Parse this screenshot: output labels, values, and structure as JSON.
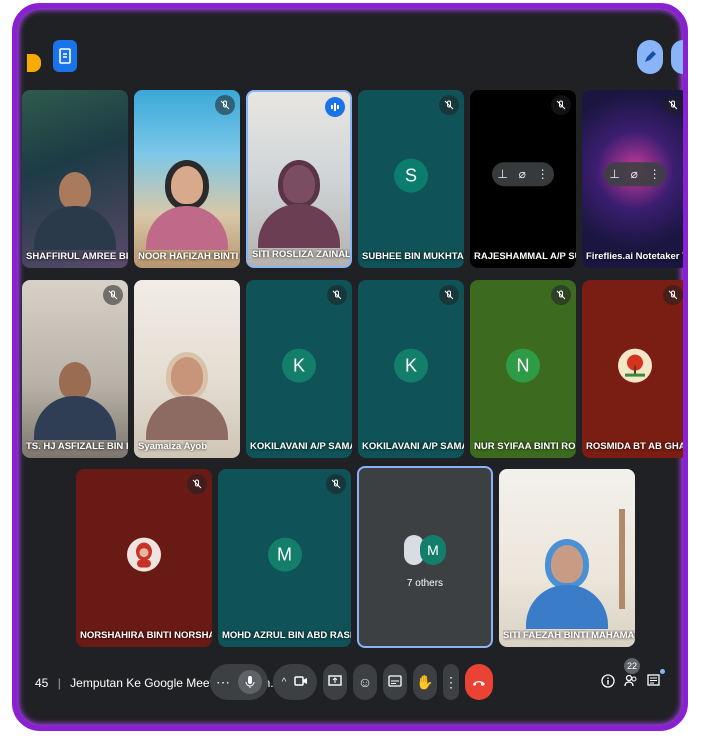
{
  "window": {
    "border_color": "#8a1fd6",
    "background": "#202124"
  },
  "tiles_row1": [
    {
      "name": "SHAFFIRUL AMREE BIN AWAN...",
      "kind": "video"
    },
    {
      "name": "NOOR HAFIZAH BINTI ABDUL...",
      "kind": "video",
      "muted": true
    },
    {
      "name": "SITI ROSLIZA ZAINAL ABIDIN...",
      "kind": "video",
      "speaking": true
    },
    {
      "name": "SUBHEE BIN MUKHTAR (MOH-...",
      "kind": "avatar",
      "initial": "S",
      "muted": true
    },
    {
      "name": "RAJESHAMMAL A/P SUBRAM...",
      "kind": "hover",
      "muted": true
    },
    {
      "name": "Fireflies.ai Notetaker TS. HJ",
      "kind": "hover",
      "muted": true
    }
  ],
  "tiles_row2": [
    {
      "name": "TS. HJ ASFIZALE BIN HJ OTHM...",
      "kind": "video",
      "muted": true
    },
    {
      "name": "Syamaiza Ayob",
      "kind": "video"
    },
    {
      "name": "KOKILAVANI A/P SAMALANAT...",
      "kind": "avatar",
      "initial": "K",
      "muted": true
    },
    {
      "name": "KOKILAVANI A/P SAMALANAT...",
      "kind": "avatar",
      "initial": "K",
      "muted": true
    },
    {
      "name": "NUR SYIFAA BINTI ROMLAN (...",
      "kind": "avatar",
      "initial": "N",
      "muted": true
    },
    {
      "name": "ROSMIDA BT AB GHANI (MOH...",
      "kind": "image-avatar",
      "muted": true
    }
  ],
  "tiles_row3": [
    {
      "name": "NORSHAHIRA BINTI NORSHAHID (MOH-...",
      "kind": "image-avatar",
      "muted": true
    },
    {
      "name": "MOHD AZRUL BIN ABD RASHID (MOH-P...",
      "kind": "avatar",
      "initial": "M",
      "muted": true
    },
    {
      "name": "7 others",
      "kind": "others",
      "initial": "M"
    },
    {
      "name": "SITI FAEZAH BINTI MAHAMAT (MOH-PU...",
      "kind": "video"
    }
  ],
  "bottombar": {
    "time_fragment": "45",
    "meeting_title": "Jemputan Ke Google Meet Perbincan...",
    "participants_count": "22",
    "icons": {
      "more_options": "more-horizontal-icon",
      "mic": "microphone-icon",
      "caret": "caret-up-icon",
      "camera": "camera-off-icon",
      "present": "present-screen-icon",
      "emoji": "emoji-icon",
      "captions": "captions-icon",
      "raise_hand": "raise-hand-icon",
      "more_vert": "more-vertical-icon",
      "end_call": "end-call-icon",
      "info": "info-icon",
      "people": "people-icon",
      "chat": "chat-icon"
    },
    "endcall_color": "#ea4335"
  }
}
